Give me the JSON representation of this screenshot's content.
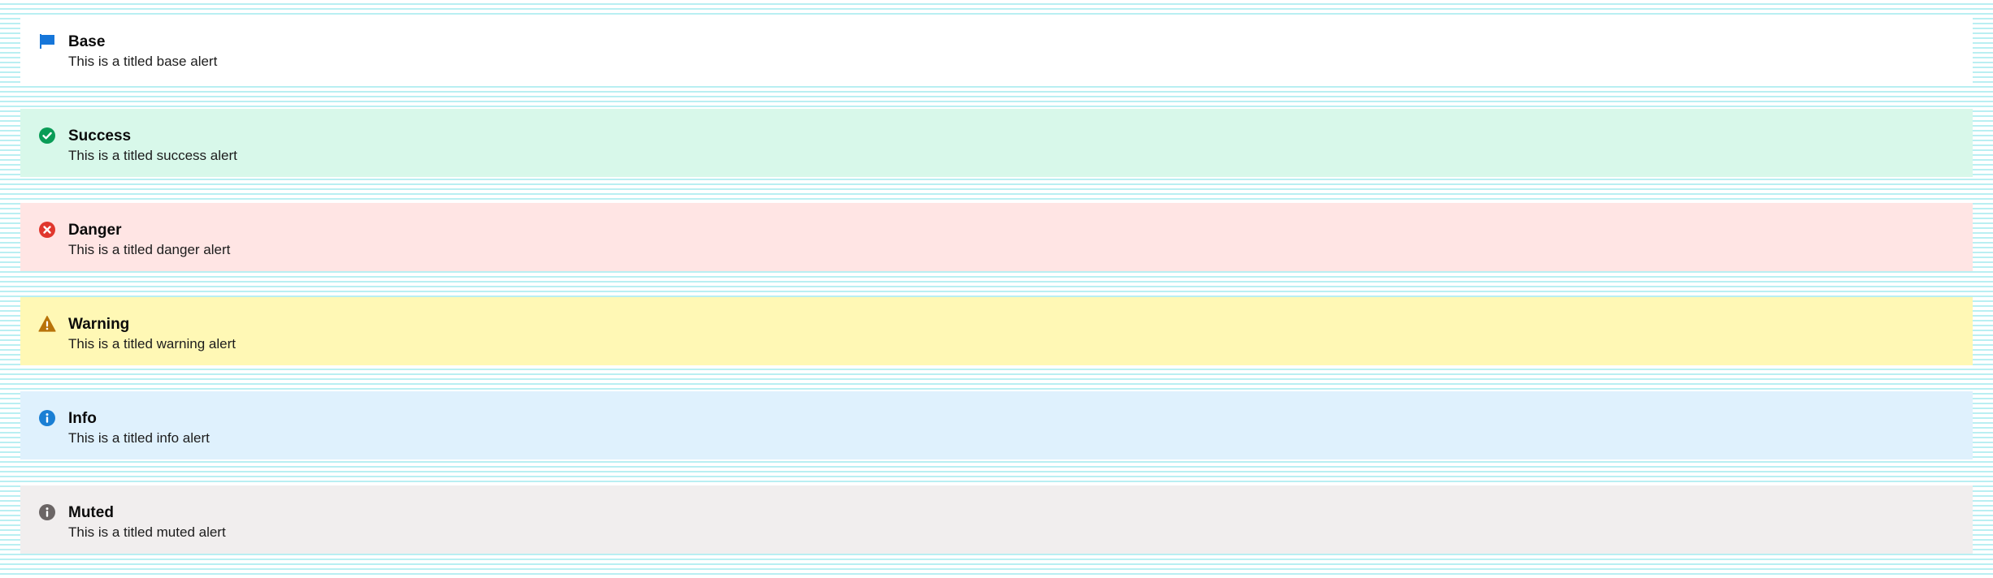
{
  "alerts": [
    {
      "variant": "base",
      "icon": "flag-icon",
      "icon_color": "#1676d9",
      "background": "#ffffff",
      "title": "Base",
      "message": "This is a titled base alert"
    },
    {
      "variant": "success",
      "icon": "check-circle-icon",
      "icon_color": "#0a9c57",
      "background": "#d8f8ea",
      "title": "Success",
      "message": "This is a titled success alert"
    },
    {
      "variant": "danger",
      "icon": "x-circle-icon",
      "icon_color": "#e0372d",
      "background": "#ffe5e4",
      "title": "Danger",
      "message": "This is a titled danger alert"
    },
    {
      "variant": "warning",
      "icon": "warning-triangle-icon",
      "icon_color": "#b8730a",
      "background": "#fff8b5",
      "title": "Warning",
      "message": "This is a titled warning alert"
    },
    {
      "variant": "info",
      "icon": "info-circle-icon",
      "icon_color": "#1a7fd4",
      "background": "#dff1fd",
      "title": "Info",
      "message": "This is a titled info alert"
    },
    {
      "variant": "muted",
      "icon": "info-circle-icon",
      "icon_color": "#6b6565",
      "background": "#f1eeee",
      "title": "Muted",
      "message": "This is a titled muted alert"
    }
  ]
}
